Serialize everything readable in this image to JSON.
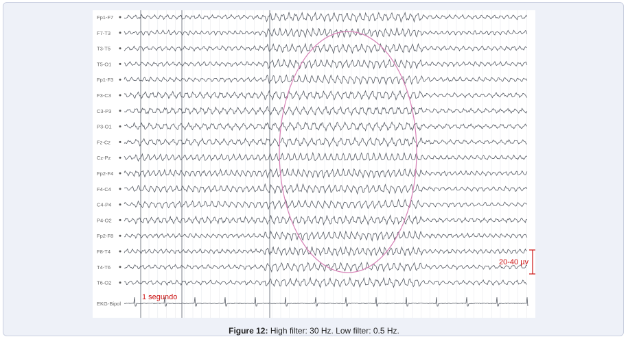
{
  "figure": {
    "channels": [
      "Fp1-F7",
      "F7-T3",
      "T3-T5",
      "T5-O1",
      "Fp1-F3",
      "F3-C3",
      "C3-P3",
      "P3-O1",
      "Fz-Cz",
      "Cz-Pz",
      "Fp2-F4",
      "F4-C4",
      "C4-P4",
      "P4-O2",
      "Fp2-F8",
      "F8-T4",
      "T4-T6",
      "T6-O2"
    ],
    "ekg_label": "EKG-Bipol",
    "time_marker_label": "1 segundo",
    "amplitude_label": "20-40 µv",
    "trace_color": "#555a63",
    "annotation_color": "#cc1111",
    "ellipse_color": "#d77fb6"
  },
  "caption": {
    "label": "Figure 12:",
    "text": "High filter: 30 Hz. Low filter: 0.5 Hz."
  }
}
